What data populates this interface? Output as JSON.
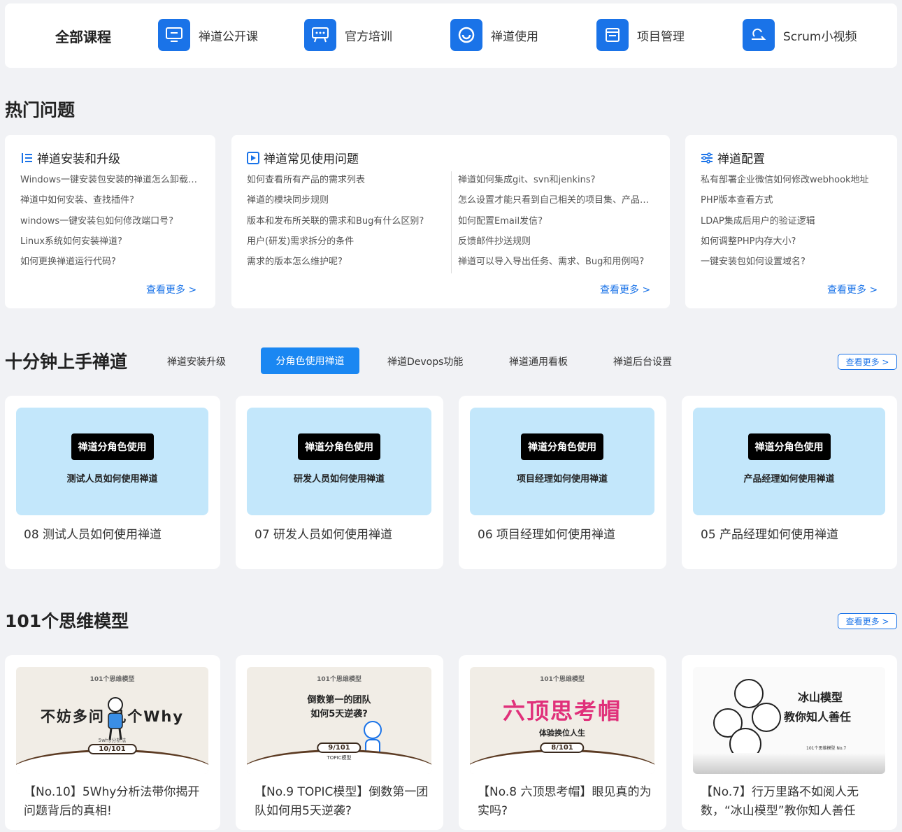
{
  "topbar": {
    "all_courses": "全部课程",
    "items": [
      {
        "label": "禅道公开课",
        "icon": "monitor-icon"
      },
      {
        "label": "官方培训",
        "icon": "presentation-icon"
      },
      {
        "label": "禅道使用",
        "icon": "zentao-logo-icon"
      },
      {
        "label": "项目管理",
        "icon": "window-icon"
      },
      {
        "label": "Scrum小视频",
        "icon": "scrum-loop-icon"
      }
    ]
  },
  "hot": {
    "title": "热门问题",
    "cards": [
      {
        "title": "禅道安装和升级",
        "icon": "list-ordered-icon",
        "items": [
          "Windows一键安装包安装的禅道怎么卸载…",
          "禅道中如何安装、查找插件?",
          "windows一键安装包如何修改端口号?",
          "Linux系统如何安装禅道?",
          "如何更换禅道运行代码?"
        ],
        "more": "查看更多 >"
      },
      {
        "title": "禅道常见使用问题",
        "icon": "play-square-icon",
        "items": [
          "如何查看所有产品的需求列表",
          "禅道的模块同步规则",
          "版本和发布所关联的需求和Bug有什么区别?",
          "用户(研发)需求拆分的条件",
          "需求的版本怎么维护呢?"
        ],
        "items2": [
          "禅道如何集成git、svn和jenkins?",
          "怎么设置才能只看到自己相关的项目集、产品…",
          "如何配置Email发信?",
          "反馈邮件抄送规则",
          "禅道可以导入导出任务、需求、Bug和用例吗?"
        ],
        "more": "查看更多 >"
      },
      {
        "title": "禅道配置",
        "icon": "sliders-icon",
        "items": [
          "私有部署企业微信如何修改webhook地址",
          "PHP版本查看方式",
          "LDAP集成后用户的验证逻辑",
          "如何调整PHP内存大小?",
          "一键安装包如何设置域名?"
        ],
        "more": "查看更多 >"
      }
    ]
  },
  "quick": {
    "title": "十分钟上手禅道",
    "tabs": [
      "禅道安装升级",
      "分角色使用禅道",
      "禅道Devops功能",
      "禅道通用看板",
      "禅道后台设置"
    ],
    "active_tab": "分角色使用禅道",
    "more": "查看更多 >",
    "videos": [
      {
        "badge": "禅道分角色使用",
        "sub": "测试人员如何使用禅道",
        "title": "08 测试人员如何使用禅道"
      },
      {
        "badge": "禅道分角色使用",
        "sub": "研发人员如何使用禅道",
        "title": "07 研发人员如何使用禅道"
      },
      {
        "badge": "禅道分角色使用",
        "sub": "项目经理如何使用禅道",
        "title": "06 项目经理如何使用禅道"
      },
      {
        "badge": "禅道分角色使用",
        "sub": "产品经理如何使用禅道",
        "title": "05 产品经理如何使用禅道"
      }
    ]
  },
  "models": {
    "title": "101个思维模型",
    "more": "查看更多 >",
    "cards": [
      {
        "tag": "101个思维模型",
        "headline": "不妨多问  几个Why",
        "caption": "5why分析法",
        "num": "10/101",
        "title": "【No.10】5Why分析法带你揭开问题背后的真相!"
      },
      {
        "tag": "101个思维模型",
        "headline": "倒数第一的团队",
        "headline2": "如何5天逆袭?",
        "caption": "TOPIC模型",
        "num": "9/101",
        "title": "【No.9 TOPIC模型】倒数第一团队如何用5天逆袭?"
      },
      {
        "tag": "101个思维模型",
        "headline": "六顶思考帽",
        "headline2": "体验换位人生",
        "num": "8/101",
        "title": "【No.8 六顶思考帽】眼见真的为实吗?"
      },
      {
        "headline": "冰山模型",
        "headline2": "教你知人善任",
        "caption": "101个思维模型 No.7",
        "title": "【No.7】行万里路不如阅人无数，“冰山模型”教你知人善任"
      }
    ]
  },
  "colors": {
    "accent": "#1a73e8",
    "thumb_bg": "#c3e7fb",
    "page_bg": "#f1f2f5"
  }
}
